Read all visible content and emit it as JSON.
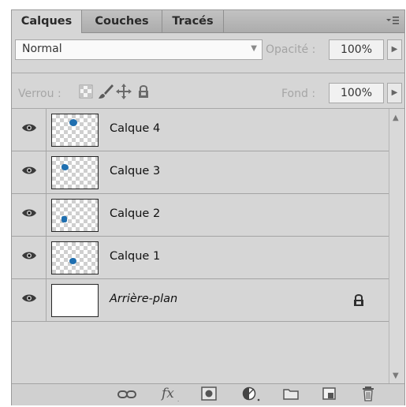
{
  "tabs": [
    "Calques",
    "Couches",
    "Tracés"
  ],
  "panel_menu_icon": "panel-menu-icon",
  "blend": {
    "mode": "Normal",
    "opacity_label": "Opacité :",
    "opacity_value": "100%"
  },
  "lock": {
    "label": "Verrou :",
    "icons": [
      "lock-transparency-icon",
      "lock-paint-icon",
      "lock-position-icon",
      "lock-all-icon"
    ],
    "fill_label": "Fond :",
    "fill_value": "100%"
  },
  "layers": [
    {
      "name": "Calque 4",
      "visible": true,
      "italic": false,
      "thumb": "checker",
      "locked": false
    },
    {
      "name": "Calque 3",
      "visible": true,
      "italic": false,
      "thumb": "checker",
      "locked": false
    },
    {
      "name": "Calque 2",
      "visible": true,
      "italic": false,
      "thumb": "checker",
      "locked": false
    },
    {
      "name": "Calque 1",
      "visible": true,
      "italic": false,
      "thumb": "checker",
      "locked": false
    },
    {
      "name": "Arrière-plan",
      "visible": true,
      "italic": true,
      "thumb": "white",
      "locked": true
    }
  ],
  "bottom_icons": [
    "link-layers-icon",
    "fx-icon",
    "add-mask-icon",
    "adjustment-layer-icon",
    "new-group-icon",
    "new-layer-icon",
    "trash-icon"
  ],
  "colors": {
    "panel_bg": "#d6d6d6",
    "accent_blob": "#1f6fb0"
  }
}
